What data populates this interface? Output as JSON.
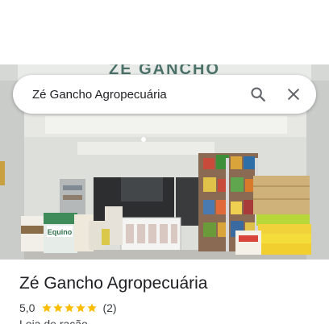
{
  "search": {
    "query": "Zé Gancho Agropecuária",
    "search_icon": "search-icon",
    "close_icon": "close-icon"
  },
  "photo": {
    "sign_text": "ZÉ GANCHO",
    "sack_label": "Equino"
  },
  "place": {
    "name": "Zé Gancho Agropecuária",
    "rating": "5,0",
    "stars": 5,
    "review_count": "(2)",
    "category": "Loja de ração"
  },
  "colors": {
    "star": "#fbbc04",
    "icon": "#5f6368",
    "text": "#202124"
  }
}
